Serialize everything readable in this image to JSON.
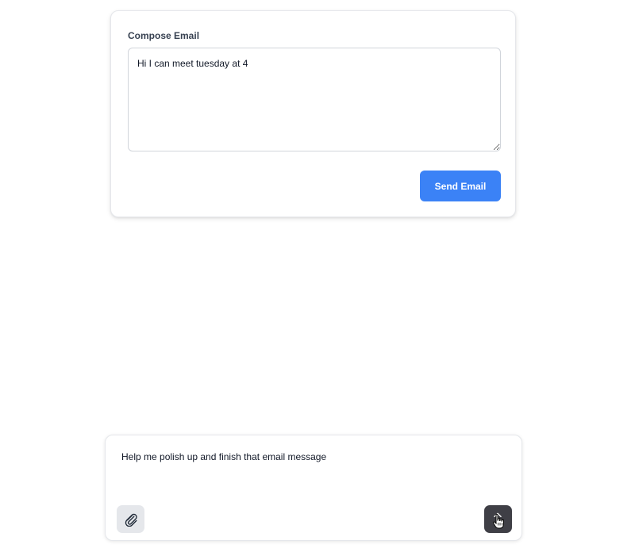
{
  "compose": {
    "label": "Compose Email",
    "body": "Hi I can meet tuesday at 4",
    "send_label": "Send Email",
    "accent_color": "#3b82f6"
  },
  "chat": {
    "message": "Help me polish up and finish that email message",
    "attach_icon": "paperclip-icon",
    "submit_icon": "arrow-up-icon"
  }
}
